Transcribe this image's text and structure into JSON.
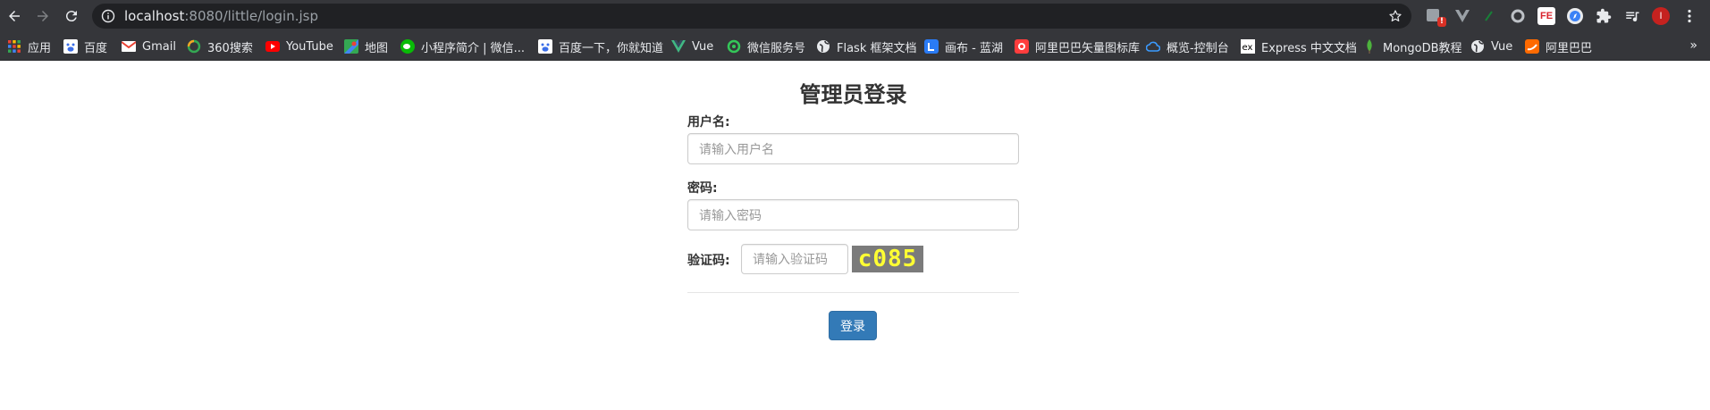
{
  "browser": {
    "url_host": "localhost",
    "url_rest": ":8080/little/login.jsp",
    "extension_badge": "!",
    "fe_ext_label": "FE",
    "profile_initial": "I"
  },
  "bookmarks": [
    {
      "label": "应用",
      "icon": "apps-grid-icon",
      "color": "#ea4335"
    },
    {
      "label": "百度",
      "icon": "baidu-icon",
      "color": "#3b6ee8"
    },
    {
      "label": "Gmail",
      "icon": "gmail-icon",
      "color": "#ea4335"
    },
    {
      "label": "360搜索",
      "icon": "360-search-icon",
      "color": "#f5a623"
    },
    {
      "label": "YouTube",
      "icon": "youtube-icon",
      "color": "#ff0000"
    },
    {
      "label": "地图",
      "icon": "maps-icon",
      "color": "#34a853"
    },
    {
      "label": "小程序简介 | 微信...",
      "icon": "wechat-icon",
      "color": "#09bb07"
    },
    {
      "label": "百度一下，你就知道",
      "icon": "baidu-icon",
      "color": "#3b6ee8"
    },
    {
      "label": "Vue",
      "icon": "vue-icon",
      "color": "#41b883"
    },
    {
      "label": "微信服务号",
      "icon": "wechat-service-icon",
      "color": "#34c759"
    },
    {
      "label": "Flask 框架文档",
      "icon": "globe-icon",
      "color": "#e8eaed"
    },
    {
      "label": "画布 - 蓝湖",
      "icon": "lanhu-icon",
      "color": "#2a7bf5"
    },
    {
      "label": "阿里巴巴矢量图标库",
      "icon": "iconfont-icon",
      "color": "#ff3d3d"
    },
    {
      "label": "概览-控制台",
      "icon": "cloud-icon",
      "color": "#3b9bff"
    },
    {
      "label": "Express 中文文档",
      "icon": "express-icon",
      "color": "#ffffff"
    },
    {
      "label": "MongoDB教程",
      "icon": "mongodb-leaf-icon",
      "color": "#4db33d"
    },
    {
      "label": "Vue",
      "icon": "globe-icon",
      "color": "#e8eaed"
    },
    {
      "label": "阿里巴巴",
      "icon": "alibaba-icon",
      "color": "#ff6a00"
    }
  ],
  "bookmarks_more": "»",
  "form": {
    "title": "管理员登录",
    "username_label": "用户名:",
    "username_placeholder": "请输入用户名",
    "password_label": "密码:",
    "password_placeholder": "请输入密码",
    "captcha_label": "验证码:",
    "captcha_placeholder": "请输入验证码",
    "captcha_text": "c085",
    "submit_label": "登录"
  }
}
